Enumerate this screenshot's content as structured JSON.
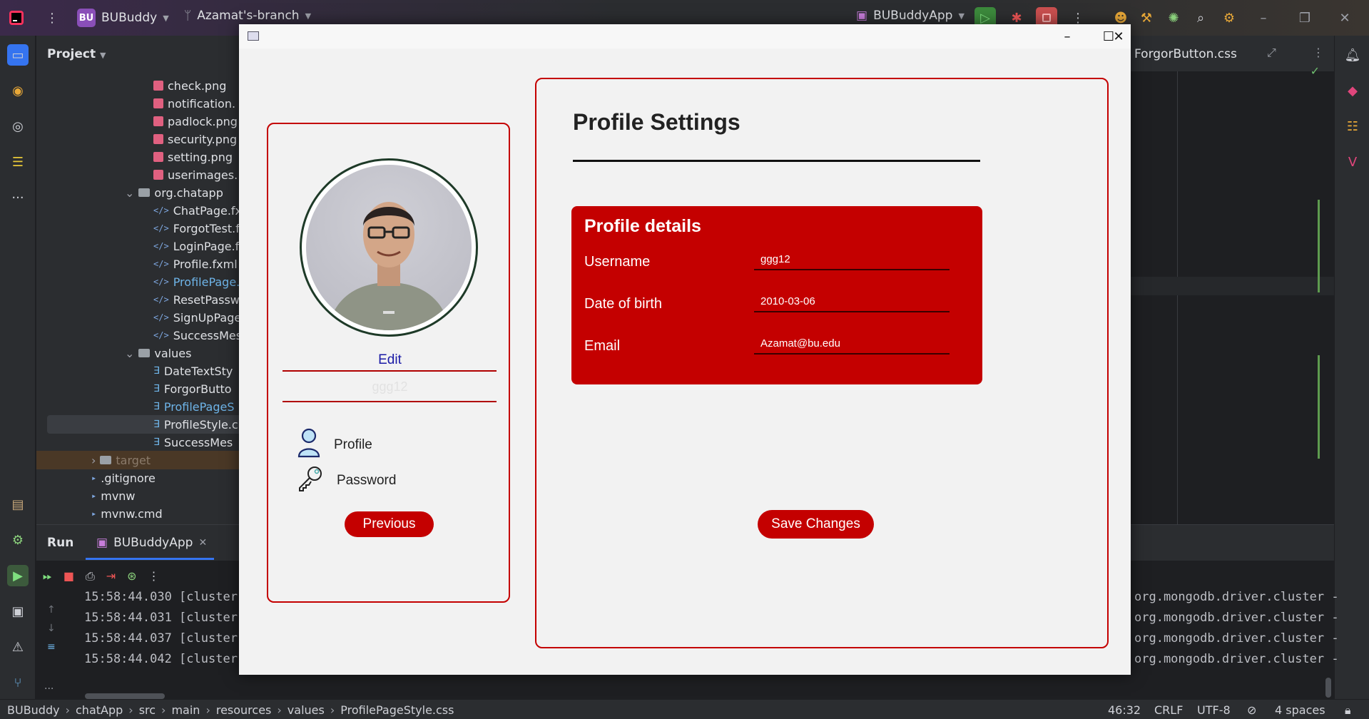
{
  "ide": {
    "project_badge": "BU",
    "project_name": "BUBuddy",
    "branch": "Azamat's-branch",
    "run_config": "BUBuddyApp",
    "panel_title": "Project",
    "editor_tab": "ForgorButton.css",
    "tree": [
      {
        "label": "check.png",
        "kind": "png"
      },
      {
        "label": "notification.",
        "kind": "png"
      },
      {
        "label": "padlock.png",
        "kind": "png"
      },
      {
        "label": "security.png",
        "kind": "png"
      },
      {
        "label": "setting.png",
        "kind": "png"
      },
      {
        "label": "userimages.",
        "kind": "png"
      },
      {
        "label": "org.chatapp",
        "kind": "folder"
      },
      {
        "label": "ChatPage.fx",
        "kind": "xml"
      },
      {
        "label": "ForgotTest.f",
        "kind": "xml"
      },
      {
        "label": "LoginPage.fx",
        "kind": "xml"
      },
      {
        "label": "Profile.fxml",
        "kind": "xml"
      },
      {
        "label": "ProfilePage.f",
        "kind": "xml"
      },
      {
        "label": "ResetPassw",
        "kind": "xml"
      },
      {
        "label": "SignUpPage",
        "kind": "xml"
      },
      {
        "label": "SuccessMes",
        "kind": "xml"
      },
      {
        "label": "values",
        "kind": "folder"
      },
      {
        "label": "DateTextSty",
        "kind": "css"
      },
      {
        "label": "ForgorButto",
        "kind": "css"
      },
      {
        "label": "ProfilePageS",
        "kind": "css"
      },
      {
        "label": "ProfileStyle.c",
        "kind": "css"
      },
      {
        "label": "SuccessMes",
        "kind": "css"
      },
      {
        "label": "target",
        "kind": "folder"
      },
      {
        "label": ".gitignore",
        "kind": "file"
      },
      {
        "label": "mvnw",
        "kind": "file"
      },
      {
        "label": "mvnw.cmd",
        "kind": "file"
      }
    ],
    "run_title": "Run",
    "run_tab": "BUBuddyApp",
    "logs_left": [
      "15:58:44.030 [cluster-",
      "15:58:44.031 [cluster-",
      "15:58:44.037 [cluster-",
      "15:58:44.042 [cluster-"
    ],
    "logs_right": [
      "org.mongodb.driver.cluster -",
      "org.mongodb.driver.cluster -",
      "org.mongodb.driver.cluster -",
      "org.mongodb.driver.cluster -"
    ],
    "breadcrumb": [
      "BUBuddy",
      "chatApp",
      "src",
      "main",
      "resources",
      "values",
      "ProfilePageStyle.css"
    ],
    "status": {
      "position": "46:32",
      "line_sep": "CRLF",
      "encoding": "UTF-8",
      "indent": "4 spaces"
    }
  },
  "app": {
    "edit_label": "Edit",
    "sidebar_username": "ggg12",
    "menu_profile": "Profile",
    "menu_password": "Password",
    "previous_label": "Previous",
    "title": "Profile Settings",
    "details_title": "Profile details",
    "username_label": "Username",
    "username_value": "ggg12",
    "dob_label": "Date of birth",
    "dob_value": "2010-03-06",
    "email_label": "Email",
    "email_value": "Azamat@bu.edu",
    "save_label": "Save Changes",
    "accent_color": "#c40000"
  }
}
